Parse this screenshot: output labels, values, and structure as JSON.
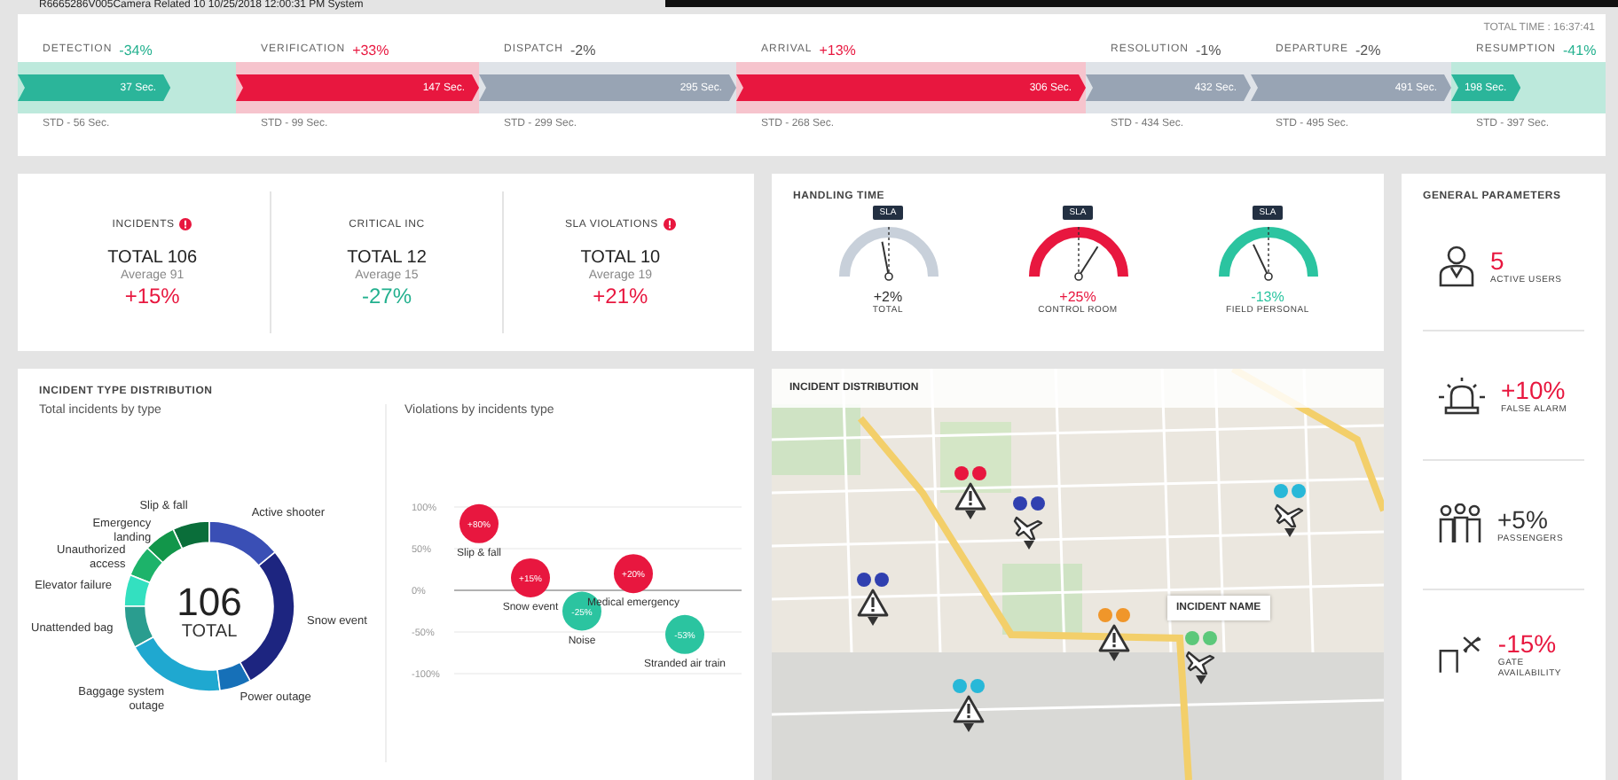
{
  "top_line": "R6665286V005Camera Related 10   10/25/2018 12:00:31 PM   System",
  "timeline": {
    "total_time": "TOTAL TIME : 16:37:41",
    "stages": [
      {
        "name": "DETECTION",
        "change": "-34%",
        "kind": "better",
        "value": "37 Sec.",
        "std": "STD - 56 Sec.",
        "level": 0.7
      },
      {
        "name": "VERIFICATION",
        "change": "+33%",
        "kind": "worse",
        "value": "147 Sec.",
        "std": "STD - 99 Sec.",
        "level": 1
      },
      {
        "name": "DISPATCH",
        "change": "-2%",
        "kind": "neutral",
        "value": "295 Sec.",
        "std": "STD - 299 Sec.",
        "level": 1
      },
      {
        "name": "ARRIVAL",
        "change": "+13%",
        "kind": "worse",
        "value": "306 Sec.",
        "std": "STD - 268 Sec.",
        "level": 1
      },
      {
        "name": "RESOLUTION",
        "change": "-1%",
        "kind": "neutral",
        "value": "432 Sec.",
        "std": "STD - 434 Sec.",
        "level": 1
      },
      {
        "name": "DEPARTURE",
        "change": "-2%",
        "kind": "neutral",
        "value": "491 Sec.",
        "std": "STD - 495 Sec.",
        "level": 1
      },
      {
        "name": "RESUMPTION",
        "change": "-41%",
        "kind": "better",
        "value": "198 Sec.",
        "std": "STD - 397 Sec.",
        "level": 0.45
      }
    ]
  },
  "kpis": [
    {
      "title": "INCIDENTS",
      "alert": true,
      "total": "TOTAL 106",
      "average": "Average 91",
      "change": "+15%",
      "kind": "worse"
    },
    {
      "title": "CRITICAL INC",
      "alert": false,
      "total": "TOTAL 12",
      "average": "Average 15",
      "change": "-27%",
      "kind": "better"
    },
    {
      "title": "SLA VIOLATIONS",
      "alert": true,
      "total": "TOTAL 10",
      "average": "Average 19",
      "change": "+21%",
      "kind": "worse"
    }
  ],
  "handling_time": {
    "title": "HANDLING TIME",
    "gauges": [
      {
        "tag": "SLA",
        "change": "+2%",
        "label": "TOTAL",
        "color": "#c8d0da",
        "level": 0.44
      },
      {
        "tag": "SLA",
        "change": "+25%",
        "label": "CONTROL ROOM",
        "color": "#e8173f",
        "level": 0.68
      },
      {
        "tag": "SLA",
        "change": "-13%",
        "label": "FIELD PERSONAL",
        "color": "#2bc4a0",
        "level": 0.36
      }
    ]
  },
  "general_parameters": {
    "title": "GENERAL PARAMETERS",
    "items": [
      {
        "kind": "user",
        "value": "5",
        "label": "ACTIVE USERS",
        "highlighted": true
      },
      {
        "kind": "siren",
        "value": "+10%",
        "label": "FALSE ALARM",
        "highlighted": true
      },
      {
        "kind": "people",
        "value": "+5%",
        "label": "PASSENGERS",
        "highlighted": false
      },
      {
        "kind": "gate",
        "value": "-15%",
        "label": "GATE AVAILABILITY",
        "highlighted": true
      }
    ]
  },
  "incident_type": {
    "title": "INCIDENT TYPE DISTRIBUTION",
    "donut": {
      "subtitle": "Total incidents by type",
      "center_value": "106",
      "center_label": "TOTAL",
      "segment_labels": [
        "Slip & fall",
        "Emergency landing",
        "Unauthorized access",
        "Elevator failure",
        "Unattended bag",
        "Baggage system outage",
        "Power outage",
        "Snow event",
        "Active shooter"
      ]
    },
    "violations": {
      "subtitle": "Violations by incidents type",
      "chart_data": {
        "type": "scatter",
        "categories": [
          "Slip & fall",
          "Snow event",
          "Noise",
          "Medical emergency",
          "Stranded air train"
        ],
        "series": [
          {
            "color": "#e8173f",
            "values": [
              80,
              15,
              null,
              20,
              null
            ]
          },
          {
            "color": "#2bc4a0",
            "values": [
              null,
              null,
              -25,
              null,
              -53
            ]
          }
        ],
        "ylim": [
          -100,
          100
        ],
        "yticks": [
          {
            "value": 100,
            "label": "100%"
          },
          {
            "value": 50,
            "label": "50%"
          },
          {
            "value": 0,
            "label": "0%"
          },
          {
            "value": -50,
            "label": "-50%"
          },
          {
            "value": -100,
            "label": "-100%"
          }
        ],
        "value_labels": [
          "+80%",
          "+15%",
          "-25%",
          "+20%",
          "-53%"
        ]
      }
    }
  },
  "map": {
    "title": "INCIDENT DISTRIBUTION",
    "tooltip": "INCIDENT NAME",
    "markers": [
      {
        "kind": "warning",
        "color": "#e8173f"
      },
      {
        "kind": "plane",
        "color": "#3040b0"
      },
      {
        "kind": "warning",
        "color": "#3040b0"
      },
      {
        "kind": "warning",
        "color": "#f0962a"
      },
      {
        "kind": "warning",
        "color": "#28b8d8"
      },
      {
        "kind": "plane",
        "color": "#5cc87a"
      },
      {
        "kind": "plane",
        "color": "#28b8d8"
      }
    ]
  }
}
